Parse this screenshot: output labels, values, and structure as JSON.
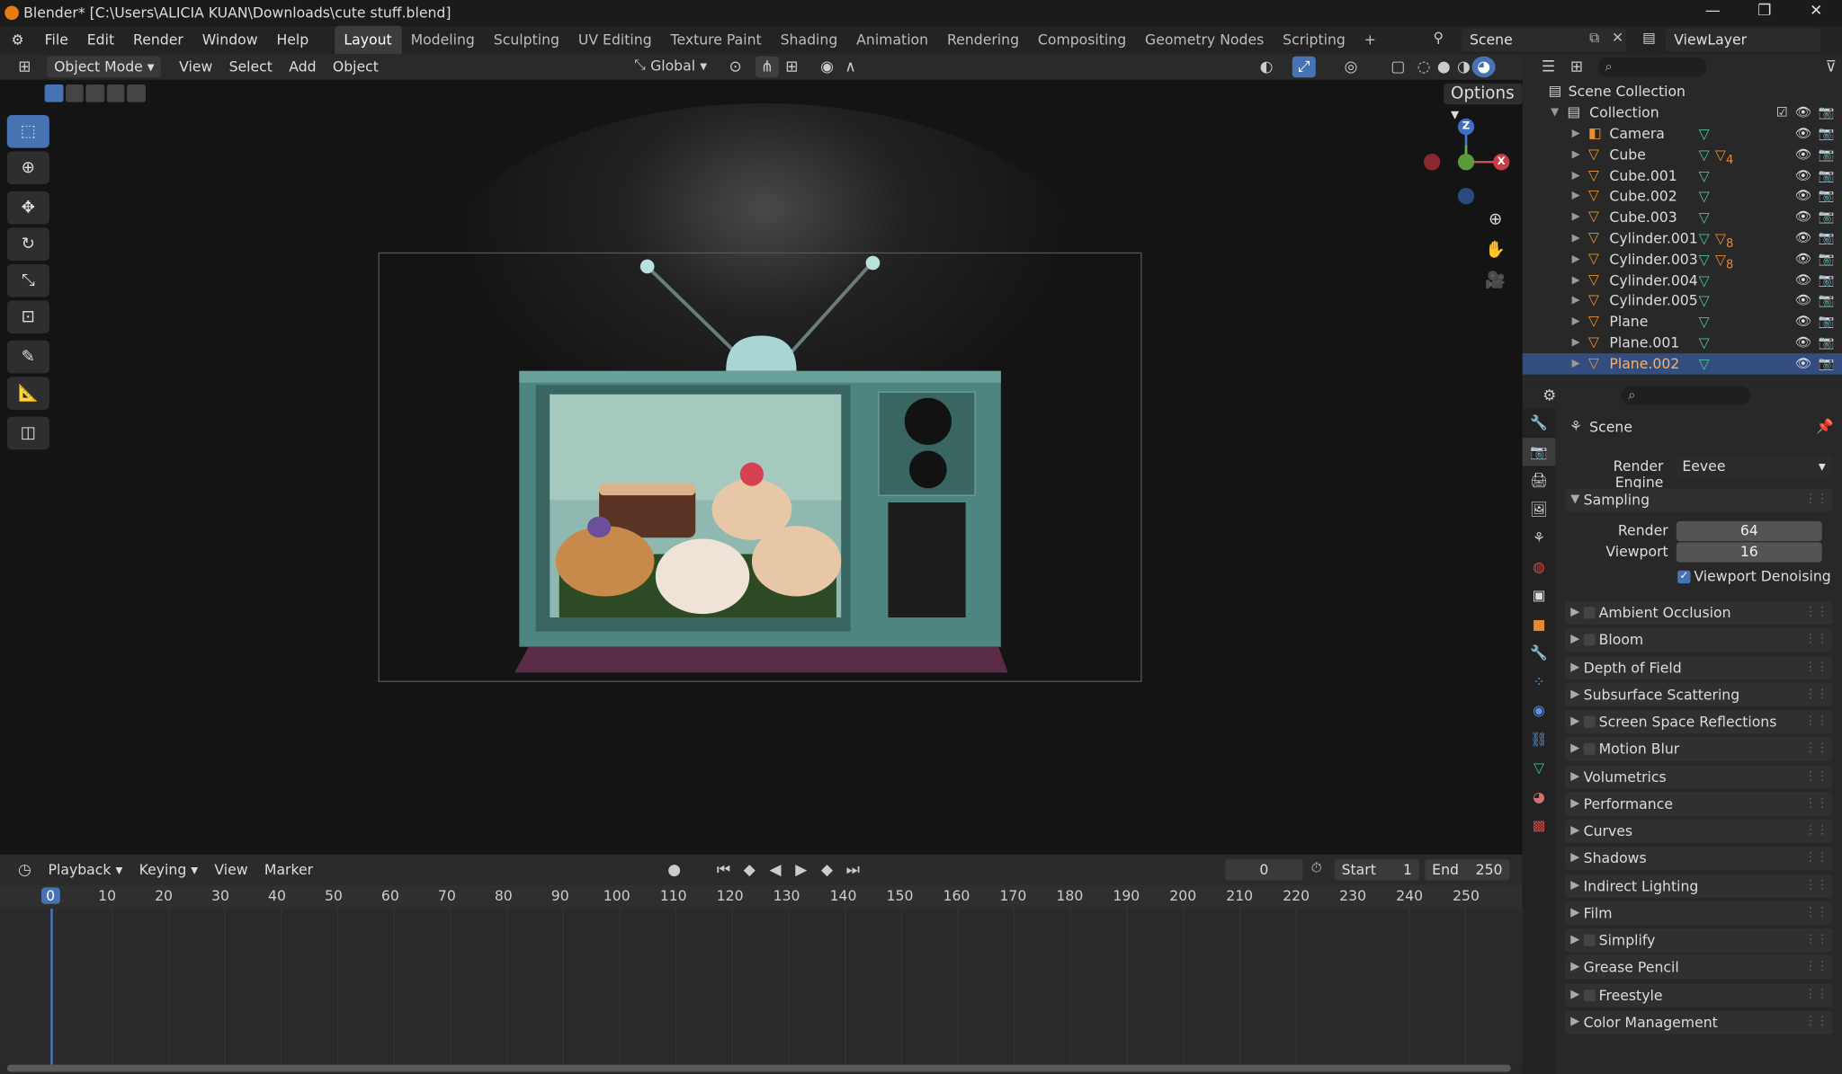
{
  "window": {
    "title": "Blender* [C:\\Users\\ALICIA KUAN\\Downloads\\cute stuff.blend]",
    "minimize": "—",
    "maximize": "❐",
    "close": "✕"
  },
  "menu": [
    "File",
    "Edit",
    "Render",
    "Window",
    "Help"
  ],
  "workspaces": [
    "Layout",
    "Modeling",
    "Sculpting",
    "UV Editing",
    "Texture Paint",
    "Shading",
    "Animation",
    "Rendering",
    "Compositing",
    "Geometry Nodes",
    "Scripting"
  ],
  "add_workspace": "+",
  "scene_field": "Scene",
  "viewlayer_field": "ViewLayer",
  "viewport": {
    "mode": "Object Mode",
    "menus": [
      "View",
      "Select",
      "Add",
      "Object"
    ],
    "orientation": "Global",
    "options_label": "Options",
    "gizmo": {
      "z": "Z",
      "x": "X"
    }
  },
  "timeline": {
    "menus": [
      "Playback",
      "Keying",
      "View",
      "Marker"
    ],
    "current_frame": "0",
    "start_label": "Start",
    "start_value": "1",
    "end_label": "End",
    "end_value": "250",
    "ruler_marks": [
      "0",
      "10",
      "20",
      "30",
      "40",
      "50",
      "60",
      "70",
      "80",
      "90",
      "100",
      "110",
      "120",
      "130",
      "140",
      "150",
      "160",
      "170",
      "180",
      "190",
      "200",
      "210",
      "220",
      "230",
      "240",
      "250"
    ],
    "playhead": "0"
  },
  "outliner": {
    "root": "Scene Collection",
    "collection": "Collection",
    "items": [
      {
        "label": "Camera",
        "icon": "camera-icon"
      },
      {
        "label": "Cube",
        "icon": "mesh-icon",
        "badge": "4"
      },
      {
        "label": "Cube.001",
        "icon": "mesh-icon"
      },
      {
        "label": "Cube.002",
        "icon": "mesh-icon"
      },
      {
        "label": "Cube.003",
        "icon": "mesh-icon"
      },
      {
        "label": "Cylinder.001",
        "icon": "mesh-icon",
        "badge": "8"
      },
      {
        "label": "Cylinder.003",
        "icon": "mesh-icon",
        "badge": "8"
      },
      {
        "label": "Cylinder.004",
        "icon": "mesh-icon"
      },
      {
        "label": "Cylinder.005",
        "icon": "mesh-icon"
      },
      {
        "label": "Plane",
        "icon": "mesh-icon"
      },
      {
        "label": "Plane.001",
        "icon": "mesh-icon"
      },
      {
        "label": "Plane.002",
        "icon": "mesh-icon",
        "selected": true
      }
    ]
  },
  "properties": {
    "breadcrumb": "Scene",
    "render_engine_label": "Render Engine",
    "render_engine": "Eevee",
    "sampling": {
      "title": "Sampling",
      "render_label": "Render",
      "render_value": "64",
      "viewport_label": "Viewport",
      "viewport_value": "16",
      "denoise_label": "Viewport Denoising"
    },
    "panels": [
      {
        "title": "Ambient Occlusion",
        "checkbox": true
      },
      {
        "title": "Bloom",
        "checkbox": true
      },
      {
        "title": "Depth of Field",
        "checkbox": false
      },
      {
        "title": "Subsurface Scattering",
        "checkbox": false
      },
      {
        "title": "Screen Space Reflections",
        "checkbox": true
      },
      {
        "title": "Motion Blur",
        "checkbox": true
      },
      {
        "title": "Volumetrics",
        "checkbox": false
      },
      {
        "title": "Performance",
        "checkbox": false
      },
      {
        "title": "Curves",
        "checkbox": false
      },
      {
        "title": "Shadows",
        "checkbox": false
      },
      {
        "title": "Indirect Lighting",
        "checkbox": false
      },
      {
        "title": "Film",
        "checkbox": false
      },
      {
        "title": "Simplify",
        "checkbox": true
      },
      {
        "title": "Grease Pencil",
        "checkbox": false
      },
      {
        "title": "Freestyle",
        "checkbox": true
      },
      {
        "title": "Color Management",
        "checkbox": false
      }
    ]
  },
  "colors": {
    "accent": "#4772b3",
    "selection": "#334d80",
    "tv_body": "#4f8580",
    "tv_base": "#5a2b44"
  }
}
